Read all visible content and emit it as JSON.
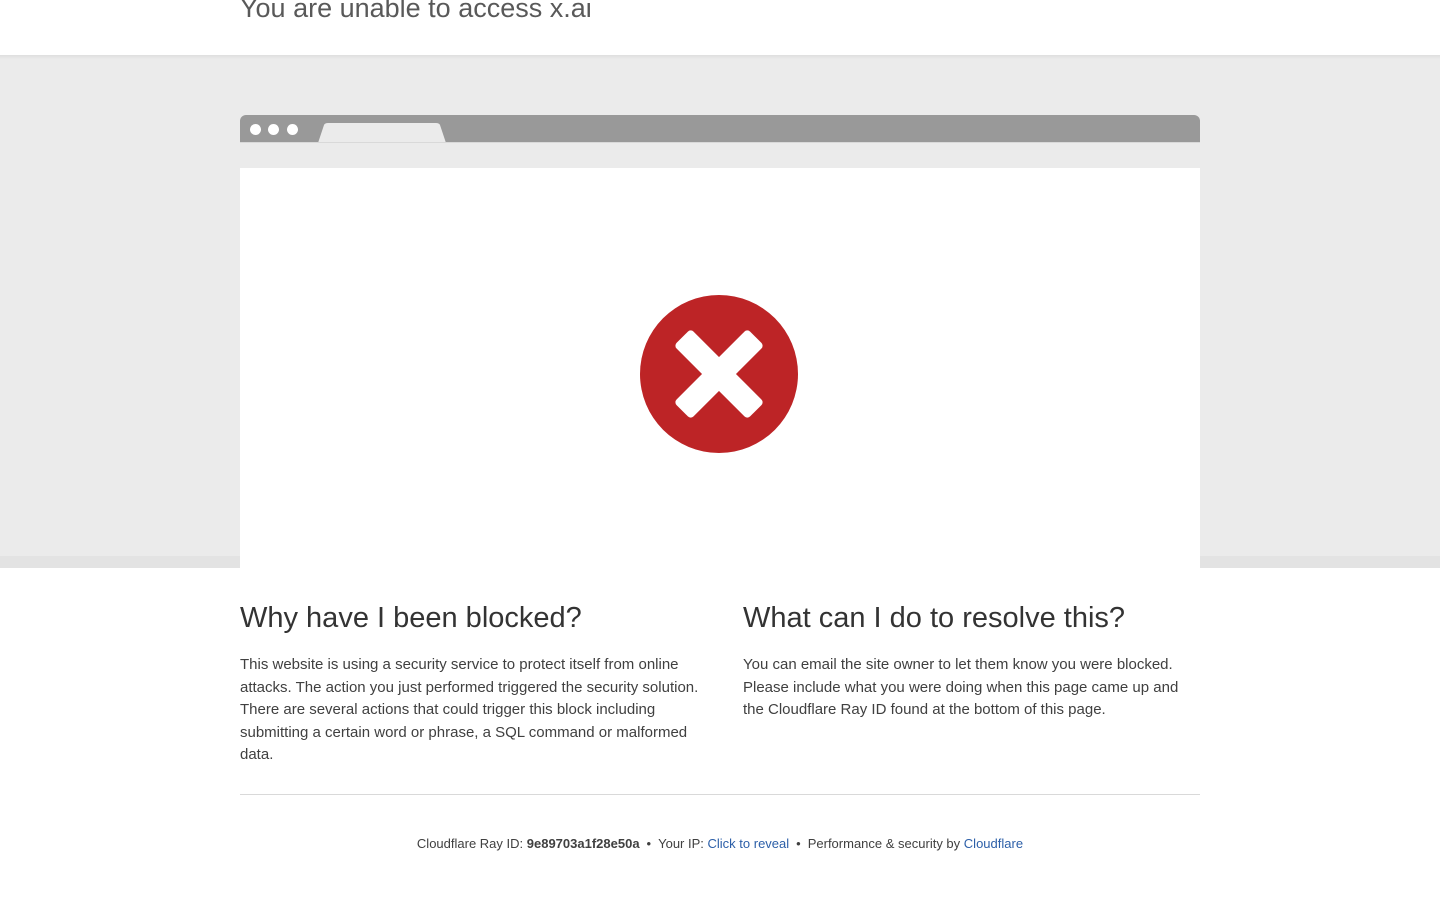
{
  "header": {
    "title": "You are unable to access x.ai"
  },
  "blocked": {
    "heading": "Why have I been blocked?",
    "body": "This website is using a security service to protect itself from online attacks. The action you just performed triggered the security solution. There are several actions that could trigger this block including submitting a certain word or phrase, a SQL command or malformed data."
  },
  "resolve": {
    "heading": "What can I do to resolve this?",
    "body": "You can email the site owner to let them know you were blocked. Please include what you were doing when this page came up and the Cloudflare Ray ID found at the bottom of this page."
  },
  "footer": {
    "ray_label": "Cloudflare Ray ID:",
    "ray_id": "9e89703a1f28e50a",
    "ip_label": "Your IP:",
    "ip_link": "Click to reveal",
    "perf_label": "Performance & security by",
    "cf_link": "Cloudflare",
    "separator": "•"
  },
  "icons": {
    "error": "x-circle-icon"
  },
  "colors": {
    "error_red": "#bd2426",
    "link_blue": "#2c5fa8",
    "band_gray": "#ebebeb",
    "chrome_gray": "#999999"
  }
}
